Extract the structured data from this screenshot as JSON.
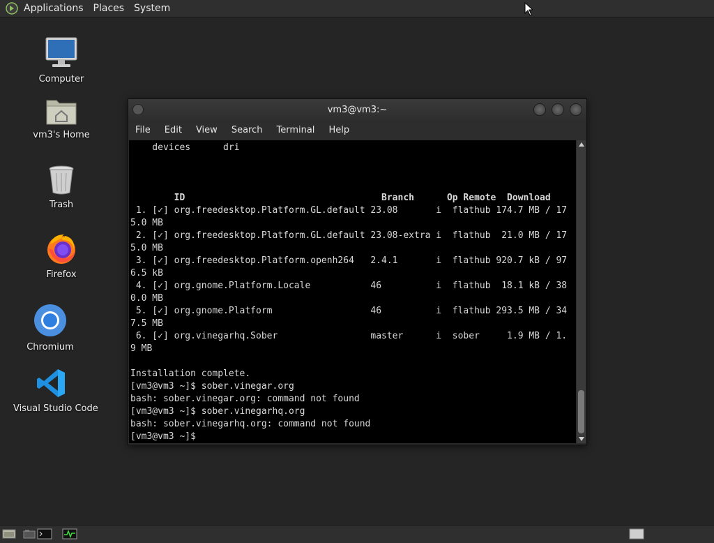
{
  "top_panel": {
    "menus": [
      "Applications",
      "Places",
      "System"
    ]
  },
  "desktop_icons": [
    {
      "label": "Computer",
      "icon": "computer-icon"
    },
    {
      "label": "vm3's Home",
      "icon": "home-folder-icon"
    },
    {
      "label": "Trash",
      "icon": "trash-icon"
    },
    {
      "label": "Firefox",
      "icon": "firefox-icon"
    },
    {
      "label": "Chromium",
      "icon": "chromium-icon"
    },
    {
      "label": "Visual Studio Code",
      "icon": "vscode-icon"
    }
  ],
  "terminal": {
    "title": "vm3@vm3:~",
    "menus": [
      "File",
      "Edit",
      "View",
      "Search",
      "Terminal",
      "Help"
    ],
    "lines": [
      "    devices      dri",
      "",
      "",
      "",
      "        ID                                    Branch      Op Remote  Download",
      " 1. [✓] org.freedesktop.Platform.GL.default 23.08       i  flathub 174.7 MB / 17",
      "5.0 MB",
      " 2. [✓] org.freedesktop.Platform.GL.default 23.08-extra i  flathub  21.0 MB / 17",
      "5.0 MB",
      " 3. [✓] org.freedesktop.Platform.openh264   2.4.1       i  flathub 920.7 kB / 97",
      "6.5 kB",
      " 4. [✓] org.gnome.Platform.Locale           46          i  flathub  18.1 kB / 38",
      "0.0 MB",
      " 5. [✓] org.gnome.Platform                  46          i  flathub 293.5 MB / 34",
      "7.5 MB",
      " 6. [✓] org.vinegarhq.Sober                 master      i  sober     1.9 MB / 1.",
      "9 MB",
      "",
      "Installation complete.",
      "[vm3@vm3 ~]$ sober.vinegar.org",
      "bash: sober.vinegar.org: command not found",
      "[vm3@vm3 ~]$ sober.vinegarhq.org",
      "bash: sober.vinegarhq.org: command not found",
      "[vm3@vm3 ~]$ "
    ]
  }
}
